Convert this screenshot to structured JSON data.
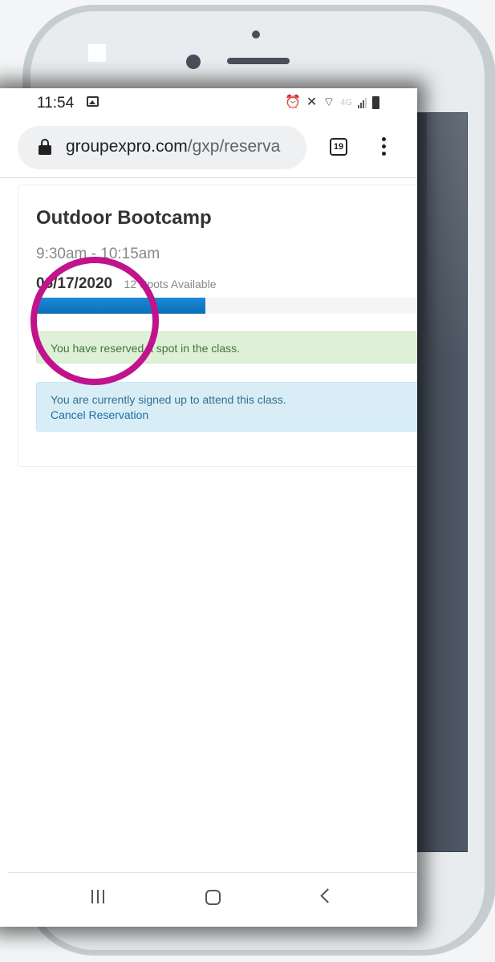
{
  "status_bar": {
    "time": "11:54",
    "network": "4G"
  },
  "browser": {
    "url_domain": "groupexpro.com",
    "url_path": "/gxp/reserva",
    "tab_count": "19"
  },
  "class_card": {
    "title": "Outdoor Bootcamp",
    "time": "9:30am - 10:15am",
    "date": "06/17/2020",
    "spots": "12 Spots Available",
    "capacity_progress": 0.44
  },
  "alerts": {
    "success_text": "You have reserved a spot in the class.",
    "info_text": "You are currently signed up to attend this class.",
    "cancel_link": "Cancel Reservation"
  },
  "colors": {
    "progress_fill": "#0c6fb8",
    "highlight_ring": "#c0138c",
    "success_bg": "#dff0d8",
    "info_bg": "#d9edf7"
  }
}
